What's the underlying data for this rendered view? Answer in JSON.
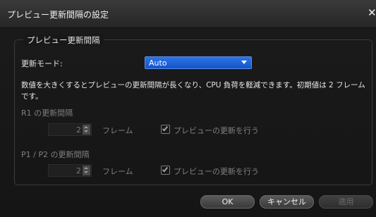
{
  "window": {
    "title": "プレビュー更新間隔の設定",
    "close_glyph": "✕"
  },
  "group": {
    "legend": "プレビュー更新間隔",
    "mode_label": "更新モード:",
    "mode_value": "Auto",
    "description": "数値を大きくするとプレビューの更新間隔が長くなり、CPU 負荷を軽減できます。初期値は 2 フレームです。"
  },
  "r1": {
    "title": "R1 の更新間隔",
    "value": "2",
    "unit": "フレーム",
    "checkbox_label": "プレビューの更新を行う",
    "checked": true
  },
  "p12": {
    "title": "P1 / P2 の更新間隔",
    "value": "2",
    "unit": "フレーム",
    "checkbox_label": "プレビューの更新を行う",
    "checked": true
  },
  "buttons": {
    "ok": "OK",
    "cancel": "キャンセル",
    "apply": "適用"
  },
  "colors": {
    "accent": "#1f63d8",
    "background": "#181818",
    "disabled_text": "#808080"
  }
}
